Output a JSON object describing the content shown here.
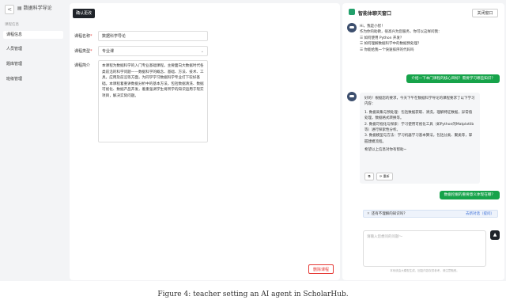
{
  "app": {
    "back_glyph": "<",
    "title": "▤ 数据科学导论"
  },
  "nav": {
    "section": "课程信息",
    "items": [
      {
        "label": "课程信息",
        "active": true
      },
      {
        "label": "人员管理",
        "active": false
      },
      {
        "label": "题库管理",
        "active": false
      },
      {
        "label": "班级管理",
        "active": false
      }
    ]
  },
  "form": {
    "confirm_label": "确认更改",
    "name_label": "课程名称",
    "name_value": "数据科学导论",
    "category_label": "课程类型",
    "category_value": "专业课",
    "category_chevron": "⌄",
    "intro_label": "课程简介",
    "intro_value": "本课程为数据科学的入门专业基础课程。主要面向大数据时代各类前沿的科学问题——数据科学的概念、基础、方法、技术、工具，应用及前沿等方面，为同学学习数据科学专业打下较好基础。本课程着重讲数据分析中的基本方法，包括数据清洗、数据可视化、数据产品开发，着重强调学生将所学的知识运用于现实项目，解决实际问题。",
    "delete_label": "删除课程"
  },
  "chat": {
    "title": "智能体聊天窗口",
    "close_label": "关闭窗口",
    "greeting": [
      "Hi，我是小智！",
      "作为你的助教，很高兴为您服务，你可以这样问我："
    ],
    "suggestions": [
      "☰ 如何使用 Python 开发？",
      "☰ 如何理解数据科学中的数据预处理？",
      "☰ 你能给我一个快速排序的代码吗"
    ],
    "user_msg_1": "介绍一下本门课程的核心目标？需要学习哪些知识？",
    "reply_intro": "好的！根据您的要求，今天下午在数据科学导论的课程要求了以下学习内容：",
    "reply_items": [
      "1. 数据采集与预处理：包括数据获取、清洗，理解特征数据，异常值处理，数据格式转换等。",
      "2. 数据可视化与探索：学习使用可视化工具（如Python的Matplotlib等）进行探索性分析。",
      "3. 数据模型与方法：学习机器学习基本算法，包括分类、聚类等，掌握建模流程。"
    ],
    "reply_footer": "希望以上信息对你有帮助~",
    "copy_icon": "⧉",
    "regen_label": "⟳ 重新",
    "user_msg_2": "数据挖掘的重要意义体现在哪？",
    "tip_close": "✕",
    "tip_text": "还有不理解的知识吗？",
    "tip_link": "去新对话（提问）",
    "input_placeholder": "请输入您想问的问题～",
    "send_glyph": "▲",
    "disclaimer": "本系统由大模型生成，回复内容仅供参考，请注意甄别。"
  },
  "caption": "Figure 4: teacher setting an AI agent in ScholarHub."
}
